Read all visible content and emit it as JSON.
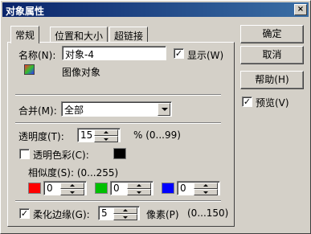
{
  "window": {
    "title": "对象属性",
    "close": "×"
  },
  "tabs": [
    "常规",
    "位置和大小",
    "超链接"
  ],
  "name": {
    "label": "名称(N):",
    "value": "对象-4"
  },
  "show": {
    "label": "显示(W)",
    "checked": true
  },
  "object_type": "图像对象",
  "merge": {
    "label": "合并(M):",
    "value": "全部"
  },
  "opacity": {
    "label": "透明度(T):",
    "value": "15",
    "range": "% (0...99)"
  },
  "transparent_color": {
    "label": "透明色彩(C):",
    "checked": false,
    "color": "#000000"
  },
  "similarity": {
    "label": "相似度(S): (0...255)",
    "channels": [
      {
        "color": "#ff0000",
        "value": "0"
      },
      {
        "color": "#00c000",
        "value": "0"
      },
      {
        "color": "#0000ff",
        "value": "0"
      }
    ]
  },
  "soften": {
    "label": "柔化边缘(G):",
    "checked": true,
    "value": "5",
    "unit": "像素(P)",
    "range": "(0...150)"
  },
  "buttons": {
    "ok": "确定",
    "cancel": "取消",
    "help": "帮助(H)"
  },
  "preview": {
    "label": "预览(V)",
    "checked": true
  }
}
